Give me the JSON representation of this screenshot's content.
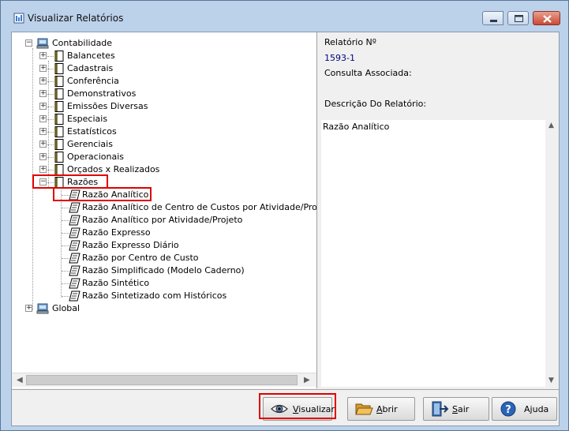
{
  "window": {
    "title": "Visualizar Relatórios"
  },
  "tree": {
    "root1": "Contabilidade",
    "folders": [
      "Balancetes",
      "Cadastrais",
      "Conferência",
      "Demonstrativos",
      "Emissões Diversas",
      "Especiais",
      "Estatísticos",
      "Gerenciais",
      "Operacionais",
      "Orçados x Realizados",
      "Razões"
    ],
    "reports": [
      "Razão Analítico",
      "Razão Analítico de Centro de Custos por Atividade/Projet",
      "Razão Analítico por Atividade/Projeto",
      "Razão Expresso",
      "Razão Expresso Diário",
      "Razão por Centro de Custo",
      "Razão Simplificado (Modelo Caderno)",
      "Razão Sintético",
      "Razão Sintetizado com Históricos"
    ],
    "root2": "Global"
  },
  "detail": {
    "report_number_label": "Relatório Nº",
    "report_number": "1593-1",
    "query_label": "Consulta Associada:",
    "description_label": "Descrição Do Relatório:",
    "description": "Razão Analítico"
  },
  "buttons": {
    "visualizar": {
      "first": "V",
      "rest": "isualizar"
    },
    "abrir": {
      "first": "A",
      "rest": "brir"
    },
    "sair": {
      "first": "S",
      "rest": "air"
    },
    "ajuda": {
      "first": "Aj",
      "rest": "uda",
      "u": "j"
    }
  },
  "colors": {
    "highlight": "#e00000",
    "value_text": "#000080",
    "window_frame": "#bcd1ea"
  }
}
